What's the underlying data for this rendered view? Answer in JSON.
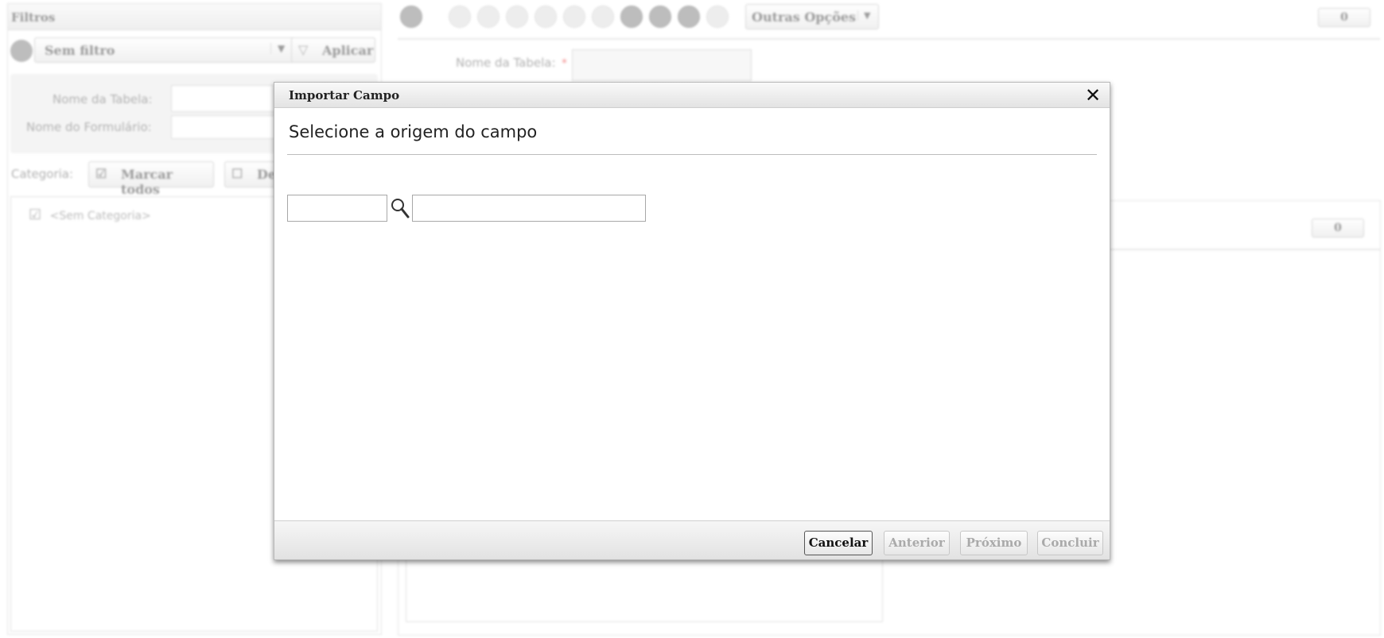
{
  "filters_panel": {
    "title": "Filtros",
    "filter_select": "Sem filtro",
    "apply_label": "Aplicar",
    "table_name_label": "Nome da Tabela:",
    "form_name_label": "Nome do Formulário:",
    "category_label": "Categoria:",
    "mark_all_label": "Marcar todos",
    "unmark_all_label": "De",
    "categories": [
      "<Sem Categoria>"
    ]
  },
  "toolbar": {
    "more_options_label": "Outras Opções",
    "counter": "0"
  },
  "form": {
    "table_name_label": "Nome da Tabela:",
    "required_mark": "*",
    "grid_counter": "0"
  },
  "dialog": {
    "title": "Importar Campo",
    "close_symbol": "✕",
    "subtitle": "Selecione a origem do campo",
    "buttons": {
      "cancel": "Cancelar",
      "previous": "Anterior",
      "next": "Próximo",
      "finish": "Concluir"
    }
  }
}
